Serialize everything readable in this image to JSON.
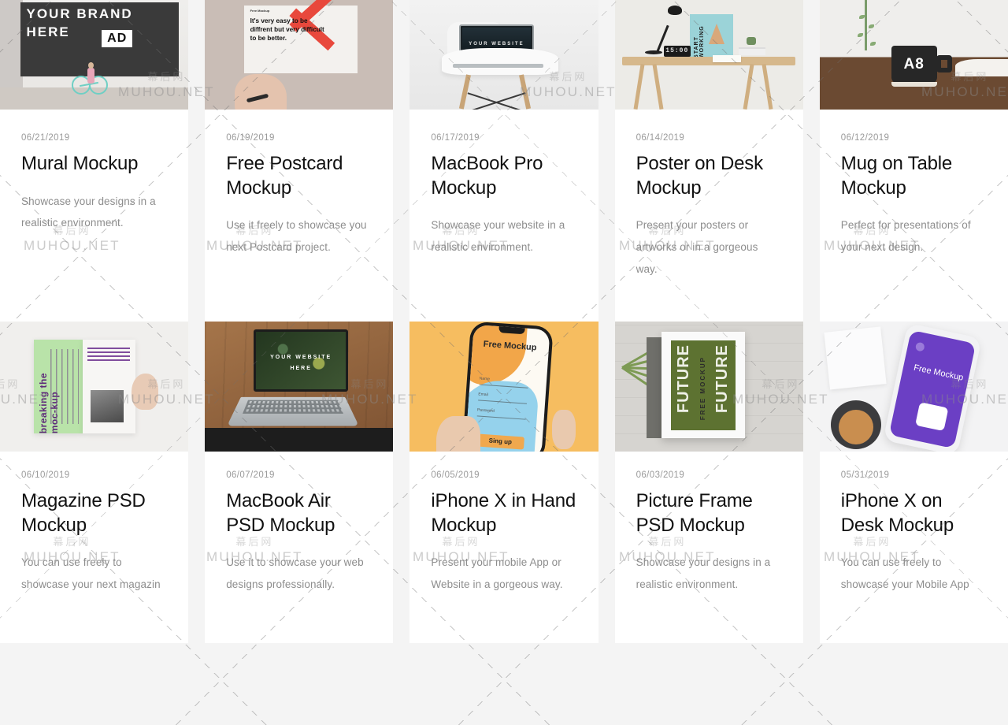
{
  "page": {
    "layout": "mockup-card-grid",
    "columns": 5,
    "background_color": "#f4f4f4",
    "card_background": "#ffffff",
    "title_color": "#111111",
    "date_color": "#9a9a9a",
    "description_color": "#8d8d8d"
  },
  "watermark": {
    "text": "MUHOU.NET",
    "text_cn": "幕后网",
    "color": "rgba(140,140,140,0.45)"
  },
  "cards": [
    {
      "date": "06/21/2019",
      "title": "Mural Mockup",
      "description": "Showcase your designs in a realistic environment.",
      "thumb": {
        "name": "mural-wall-thumbnail",
        "wall_text": "YOUR BRAND HERE",
        "badge_text": "AD"
      }
    },
    {
      "date": "06/19/2019",
      "title": "Free Postcard Mockup",
      "description": "Use it freely to showcase you next Postcard project.",
      "thumb": {
        "name": "postcard-in-hand-thumbnail",
        "kicker": "Free Mockup",
        "quote": "It's very easy to be diffrent but very difficult to be better."
      }
    },
    {
      "date": "06/17/2019",
      "title": "MacBook Pro Mockup",
      "description": "Showcase your website in a realistic environment.",
      "thumb": {
        "name": "macbook-pro-on-chair-thumbnail",
        "screen_text": "YOUR WEBSITE HERE"
      }
    },
    {
      "date": "06/14/2019",
      "title": "Poster on Desk Mockup",
      "description": "Present your posters or artworks or in a gorgeous way.",
      "thumb": {
        "name": "poster-on-desk-thumbnail",
        "poster_text": "START WORKING",
        "clock_time": "15:00"
      }
    },
    {
      "date": "06/12/2019",
      "title": "Mug on Table Mockup",
      "description": "Perfect for presentations of your next design.",
      "thumb": {
        "name": "mug-on-table-thumbnail",
        "mug_text": "A8"
      }
    },
    {
      "date": "06/10/2019",
      "title": "Magazine PSD Mockup",
      "description": "You can use freely to showcase your next magazin",
      "thumb": {
        "name": "magazine-spread-thumbnail",
        "headline": "breaking the moc-kup"
      }
    },
    {
      "date": "06/07/2019",
      "title": "MacBook Air PSD Mockup",
      "description": "Use it to showcase your web designs professionally.",
      "thumb": {
        "name": "macbook-air-on-wood-desk-thumbnail",
        "screen_text": "YOUR WEBSITE HERE"
      }
    },
    {
      "date": "06/05/2019",
      "title": "iPhone X in Hand Mockup",
      "description": "Present your mobile App or Website in a gorgeous way.",
      "thumb": {
        "name": "iphone-x-in-hand-thumbnail",
        "screen_title": "Free Mockup",
        "field_1": "Name",
        "field_2": "Email",
        "field_3": "Password",
        "button": "Sing up"
      }
    },
    {
      "date": "06/03/2019",
      "title": "Picture Frame PSD Mockup",
      "description": "Showcase your designs in a realistic environment.",
      "thumb": {
        "name": "picture-frame-thumbnail",
        "poster_word_left": "FUTURE",
        "poster_word_right": "FUTURE",
        "poster_center": "FREE MOCKUP"
      }
    },
    {
      "date": "05/31/2019",
      "title": "iPhone X on Desk Mockup",
      "description": "You can use freely to showcase your Mobile App",
      "thumb": {
        "name": "iphone-x-on-desk-thumbnail",
        "screen_title": "Free Mockup"
      }
    }
  ]
}
